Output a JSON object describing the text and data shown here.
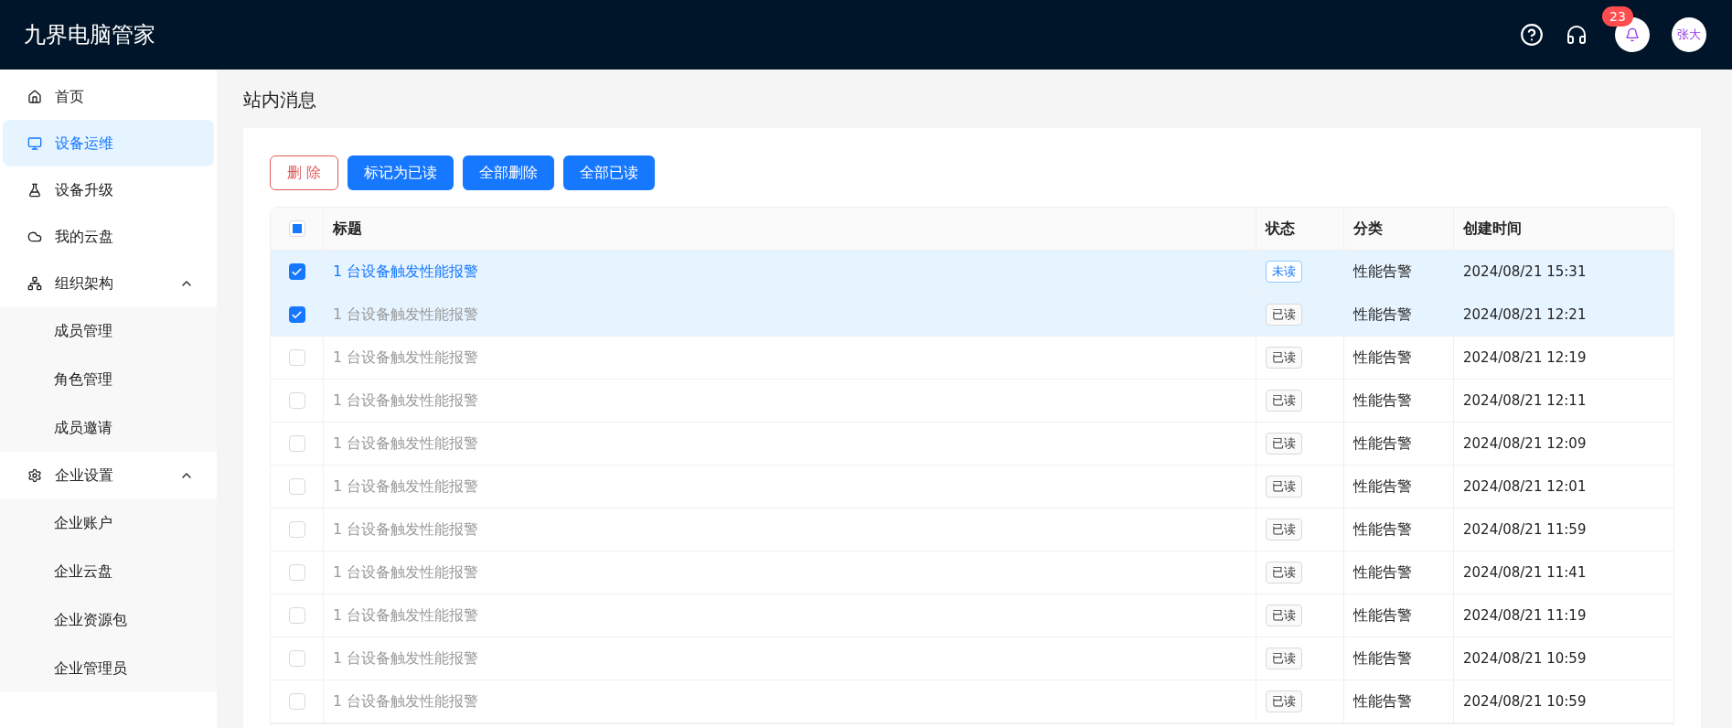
{
  "app": {
    "title": "九界电脑管家",
    "notification_count": "23",
    "avatar": "张大"
  },
  "sidebar": {
    "items": [
      {
        "label": "首页",
        "selected": false
      },
      {
        "label": "设备运维",
        "selected": true
      },
      {
        "label": "设备升级",
        "selected": false
      },
      {
        "label": "我的云盘",
        "selected": false
      },
      {
        "label": "组织架构",
        "selected": false,
        "expanded": true,
        "children": [
          {
            "label": "成员管理",
            "selected": false
          },
          {
            "label": "角色管理",
            "selected": false
          },
          {
            "label": "成员邀请",
            "selected": false
          }
        ]
      },
      {
        "label": "企业设置",
        "selected": false,
        "expanded": true,
        "children": [
          {
            "label": "企业账户",
            "selected": false
          },
          {
            "label": "企业云盘",
            "selected": false
          },
          {
            "label": "企业资源包",
            "selected": false
          },
          {
            "label": "企业管理员",
            "selected": false
          }
        ]
      }
    ]
  },
  "page_title": "站内消息",
  "toolbar": [
    {
      "label": "删 除",
      "kind": "danger"
    },
    {
      "label": "标记为已读",
      "kind": "primary"
    },
    {
      "label": "全部删除",
      "kind": "primary"
    },
    {
      "label": "全部已读",
      "kind": "primary"
    }
  ],
  "table": {
    "select_all": {
      "indeterminate": true
    },
    "columns": [
      "标题",
      "状态",
      "分类",
      "创建时间"
    ],
    "rows": [
      {
        "checked": true,
        "unread": true,
        "title": "1 台设备触发性能报警",
        "status": "未读",
        "category": "性能告警",
        "created": "2024/08/21 15:31"
      },
      {
        "checked": true,
        "unread": false,
        "title": "1 台设备触发性能报警",
        "status": "已读",
        "category": "性能告警",
        "created": "2024/08/21 12:21"
      },
      {
        "checked": false,
        "unread": false,
        "title": "1 台设备触发性能报警",
        "status": "已读",
        "category": "性能告警",
        "created": "2024/08/21 12:19"
      },
      {
        "checked": false,
        "unread": false,
        "title": "1 台设备触发性能报警",
        "status": "已读",
        "category": "性能告警",
        "created": "2024/08/21 12:11"
      },
      {
        "checked": false,
        "unread": false,
        "title": "1 台设备触发性能报警",
        "status": "已读",
        "category": "性能告警",
        "created": "2024/08/21 12:09"
      },
      {
        "checked": false,
        "unread": false,
        "title": "1 台设备触发性能报警",
        "status": "已读",
        "category": "性能告警",
        "created": "2024/08/21 12:01"
      },
      {
        "checked": false,
        "unread": false,
        "title": "1 台设备触发性能报警",
        "status": "已读",
        "category": "性能告警",
        "created": "2024/08/21 11:59"
      },
      {
        "checked": false,
        "unread": false,
        "title": "1 台设备触发性能报警",
        "status": "已读",
        "category": "性能告警",
        "created": "2024/08/21 11:41"
      },
      {
        "checked": false,
        "unread": false,
        "title": "1 台设备触发性能报警",
        "status": "已读",
        "category": "性能告警",
        "created": "2024/08/21 11:19"
      },
      {
        "checked": false,
        "unread": false,
        "title": "1 台设备触发性能报警",
        "status": "已读",
        "category": "性能告警",
        "created": "2024/08/21 10:59"
      },
      {
        "checked": false,
        "unread": false,
        "title": "1 台设备触发性能报警",
        "status": "已读",
        "category": "性能告警",
        "created": "2024/08/21 10:59"
      }
    ]
  }
}
